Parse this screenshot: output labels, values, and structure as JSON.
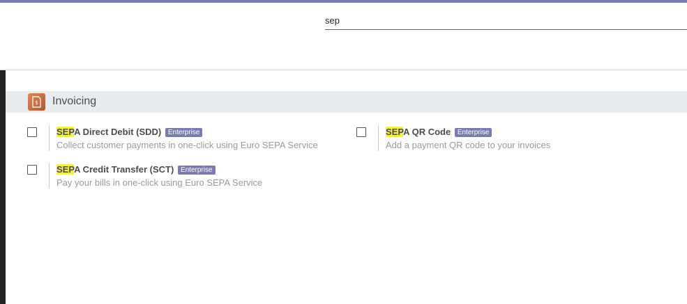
{
  "search": {
    "value": "sep"
  },
  "section": {
    "title": "Invoicing",
    "icon": "invoice-icon"
  },
  "settings": [
    {
      "highlight": "SEP",
      "title_rest": "A Direct Debit (SDD)",
      "badge": "Enterprise",
      "description": "Collect customer payments in one-click using Euro SEPA Service",
      "checked": false
    },
    {
      "highlight": "SEP",
      "title_rest": "A QR Code",
      "badge": "Enterprise",
      "description": "Add a payment QR code to your invoices",
      "checked": false
    },
    {
      "highlight": "SEP",
      "title_rest": "A Credit Transfer (SCT)",
      "badge": "Enterprise",
      "description": "Pay your bills in one-click using Euro SEPA Service",
      "checked": false
    }
  ],
  "colors": {
    "brand": "#7c7bad",
    "highlight": "#f4ef4d",
    "section_bg": "#e9ecef"
  }
}
